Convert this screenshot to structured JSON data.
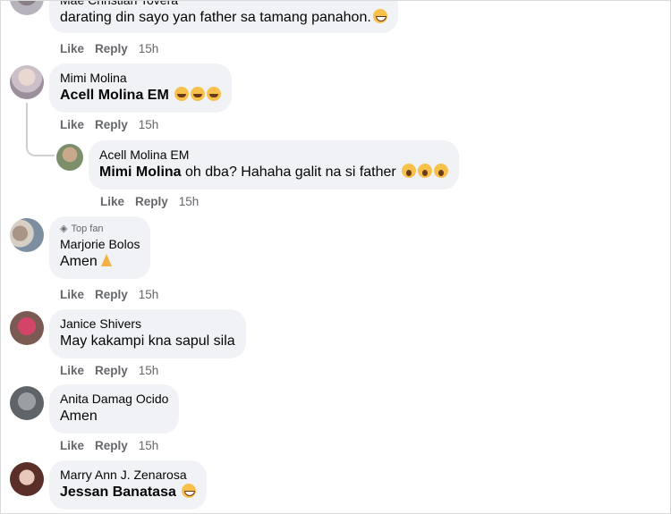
{
  "comments": [
    {
      "name": "Mae Christian Tovera",
      "text": "darating din sayo yan father sa tamang panahon.",
      "emoji": [
        "grin"
      ],
      "actions": {
        "like": "Like",
        "reply": "Reply",
        "time": "15h"
      }
    },
    {
      "name": "Mimi Molina",
      "mention": "Acell Molina EM",
      "text": "",
      "emoji": [
        "laugh",
        "laugh",
        "laugh"
      ],
      "actions": {
        "like": "Like",
        "reply": "Reply",
        "time": "15h"
      }
    },
    {
      "name": "Acell Molina EM",
      "mention": "Mimi Molina",
      "text": " oh dba? Hahaha galit na si father ",
      "emoji": [
        "shock",
        "shock",
        "shock"
      ],
      "actions": {
        "like": "Like",
        "reply": "Reply",
        "time": "15h"
      }
    },
    {
      "badge": "Top fan",
      "name": "Marjorie Bolos",
      "text": "Amen",
      "emoji": [
        "pray"
      ],
      "actions": {
        "like": "Like",
        "reply": "Reply",
        "time": "15h"
      }
    },
    {
      "name": "Janice Shivers",
      "text": "May kakampi kna sapul sila",
      "actions": {
        "like": "Like",
        "reply": "Reply",
        "time": "15h"
      }
    },
    {
      "name": "Anita Damag Ocido",
      "text": "Amen",
      "actions": {
        "like": "Like",
        "reply": "Reply",
        "time": "15h"
      }
    },
    {
      "name": "Marry Ann J. Zenarosa",
      "mention": "Jessan Banatasa",
      "text": "",
      "emoji": [
        "grin"
      ]
    }
  ],
  "colors": {
    "bubble": "#f0f2f5",
    "secondary_text": "#65676b",
    "emoji_yellow": "#f7c14b"
  }
}
